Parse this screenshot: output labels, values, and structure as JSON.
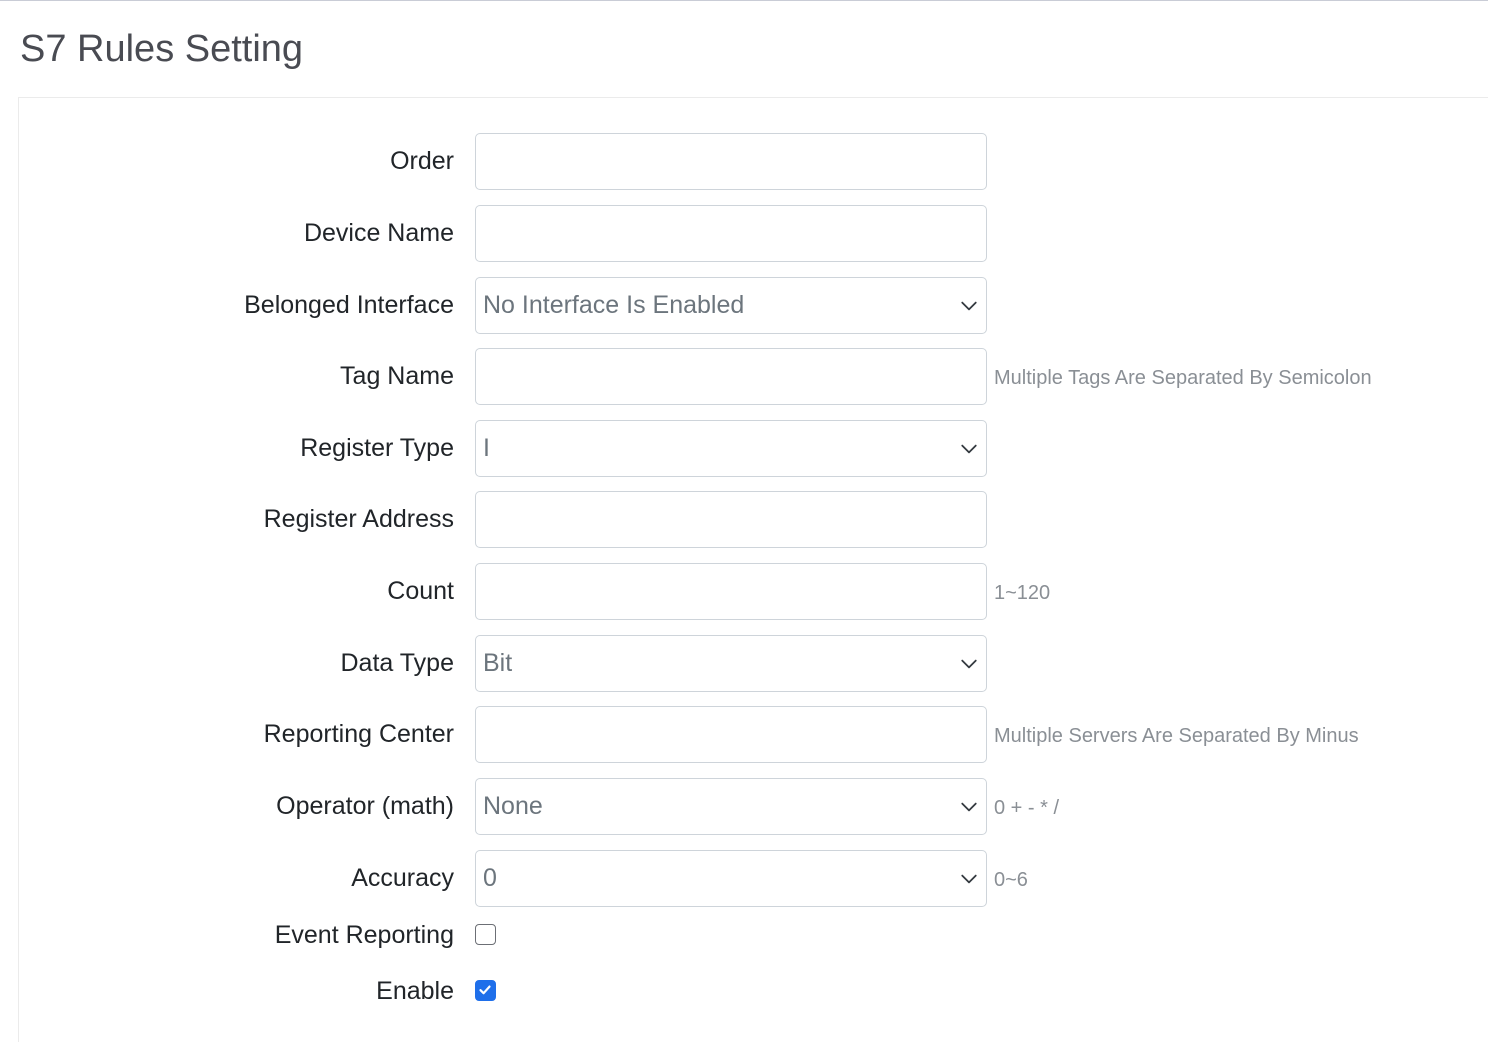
{
  "page": {
    "title": "S7 Rules Setting"
  },
  "form": {
    "order": {
      "label": "Order",
      "value": ""
    },
    "device_name": {
      "label": "Device Name",
      "value": ""
    },
    "belonged_interface": {
      "label": "Belonged Interface",
      "selected": "No Interface Is Enabled"
    },
    "tag_name": {
      "label": "Tag Name",
      "value": "",
      "hint": "Multiple Tags Are Separated By Semicolon"
    },
    "register_type": {
      "label": "Register Type",
      "selected": "I"
    },
    "register_address": {
      "label": "Register Address",
      "value": ""
    },
    "count": {
      "label": "Count",
      "value": "",
      "hint": "1~120"
    },
    "data_type": {
      "label": "Data Type",
      "selected": "Bit"
    },
    "reporting_center": {
      "label": "Reporting Center",
      "value": "",
      "hint": "Multiple Servers Are Separated By Minus"
    },
    "operator": {
      "label": "Operator (math)",
      "selected": "None",
      "hint": "0 + - * /"
    },
    "accuracy": {
      "label": "Accuracy",
      "selected": "0",
      "hint": "0~6"
    },
    "event_reporting": {
      "label": "Event Reporting",
      "checked": false
    },
    "enable": {
      "label": "Enable",
      "checked": true
    }
  },
  "icons": {
    "select_arrow": "chevron-down-icon",
    "check": "checkmark-icon"
  },
  "colors": {
    "checkbox_accent": "#1f6fea",
    "title": "#494b52",
    "hint": "#8a8f95"
  }
}
